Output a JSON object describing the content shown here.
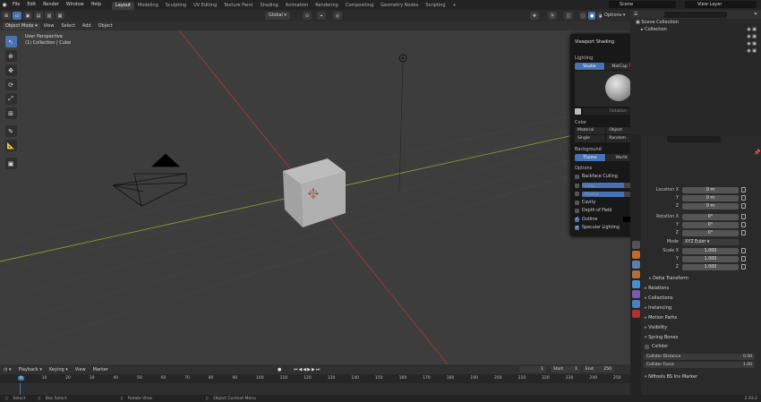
{
  "topbar": {
    "menus": [
      "File",
      "Edit",
      "Render",
      "Window",
      "Help"
    ],
    "workspaces": [
      "Layout",
      "Modeling",
      "Sculpting",
      "UV Editing",
      "Texture Paint",
      "Shading",
      "Animation",
      "Rendering",
      "Compositing",
      "Geometry Nodes",
      "Scripting"
    ],
    "active_workspace": "Layout",
    "scene": "Scene",
    "view_layer": "View Layer"
  },
  "header": {
    "transform_orientation": "Global",
    "options_label": "Options"
  },
  "viewport_header": {
    "mode": "Object Mode",
    "menus": [
      "View",
      "Select",
      "Add",
      "Object"
    ]
  },
  "viewport": {
    "perspective_label": "User Perspective",
    "collection_label": "(1) Collection | Cube"
  },
  "shading_popup": {
    "title": "Viewport Shading",
    "lighting_label": "Lighting",
    "lighting_options": [
      "Studio",
      "MatCap",
      "Flat"
    ],
    "lighting_selected": "Studio",
    "rotation_label": "Rotation",
    "rotation_value": "0°",
    "color_label": "Color",
    "color_options": [
      "Material",
      "Object",
      "Vertex",
      "Single",
      "Random",
      "Texture"
    ],
    "color_selected": "Texture",
    "background_label": "Background",
    "background_options": [
      "Theme",
      "World",
      "Viewport"
    ],
    "background_selected": "Theme",
    "options_label": "Options",
    "backface_culling": "Backface Culling",
    "xray": "X-Ray",
    "xray_value": "0.500",
    "shadow": "Shadow",
    "shadow_value": "0.500",
    "cavity": "Cavity",
    "depth_of_field": "Depth of Field",
    "outline": "Outline",
    "specular_lighting": "Specular Lighting"
  },
  "outliner": {
    "scene_collection": "Scene Collection",
    "collection": "Collection"
  },
  "properties": {
    "location_label": "Location X",
    "loc": [
      "0 m",
      "0 m",
      "0 m"
    ],
    "rotation_label": "Rotation X",
    "rot": [
      "0°",
      "0°",
      "0°"
    ],
    "axis_y": "Y",
    "axis_z": "Z",
    "mode_label": "Mode",
    "mode_value": "XYZ Euler",
    "scale_label": "Scale X",
    "scale": [
      "1.000",
      "1.000",
      "1.000"
    ],
    "delta_transform": "Delta Transform",
    "relations": "Relations",
    "collections": "Collections",
    "instancing": "Instancing",
    "motion_paths": "Motion Paths",
    "visibility": "Visibility",
    "spring_bones": "Spring Bones",
    "collider": "Collider",
    "collider_distance_label": "Collider Distance",
    "collider_distance": "0.50",
    "collider_force_label": "Collider Force",
    "collider_force": "1.00",
    "nifty_marker": "Niftools BS Inv Marker"
  },
  "timeline": {
    "menus": [
      "Playback",
      "Keying",
      "View",
      "Marker"
    ],
    "current_frame": "1",
    "start_label": "Start",
    "start": "1",
    "end_label": "End",
    "end": "250",
    "ruler": [
      "0",
      "10",
      "20",
      "30",
      "40",
      "50",
      "60",
      "70",
      "80",
      "90",
      "100",
      "110",
      "120",
      "130",
      "140",
      "150",
      "160",
      "170",
      "180",
      "190",
      "200",
      "210",
      "220",
      "230",
      "240",
      "250"
    ]
  },
  "statusbar": {
    "select": "Select",
    "box_select": "Box Select",
    "rotate_view": "Rotate View",
    "context_menu": "Object Context Menu",
    "version": "2.93.2"
  },
  "colors": {
    "accent": "#4772b3",
    "highlight_circle": "#e02020"
  }
}
